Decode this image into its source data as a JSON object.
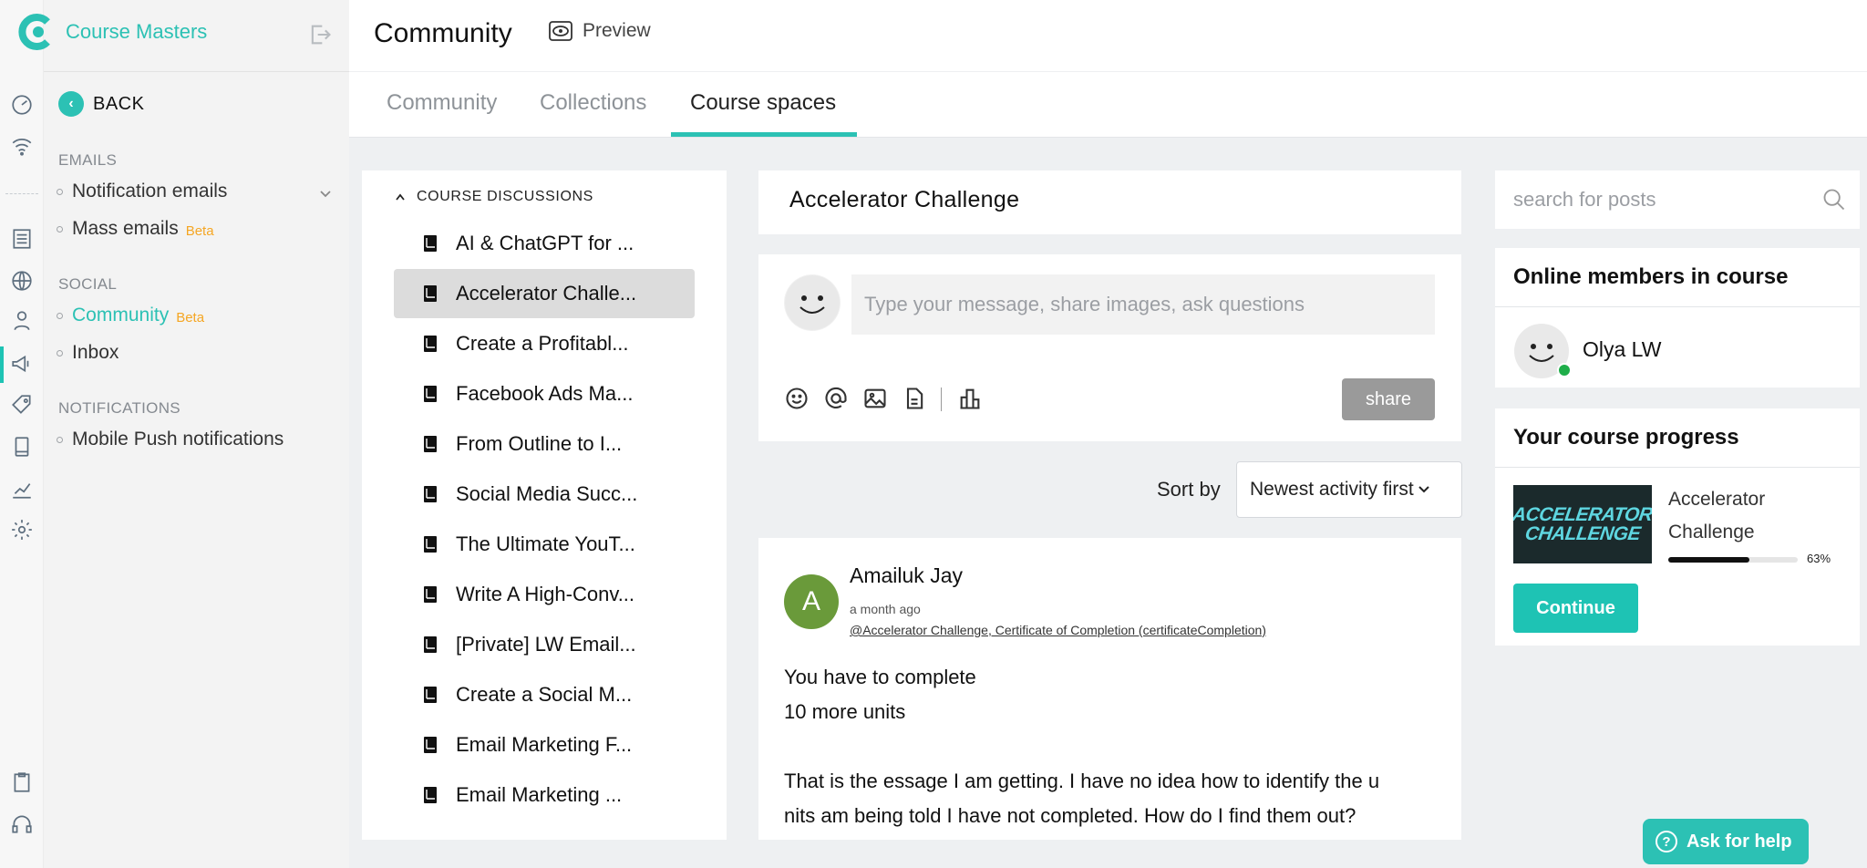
{
  "app": {
    "brand": "Course Masters",
    "page_title": "Community",
    "preview_label": "Preview"
  },
  "sidebar": {
    "back_label": "BACK",
    "sections": [
      {
        "title": "EMAILS",
        "items": [
          {
            "label": "Notification emails"
          },
          {
            "label": "Mass emails",
            "badge": "Beta"
          }
        ]
      },
      {
        "title": "SOCIAL",
        "items": [
          {
            "label": "Community",
            "badge": "Beta"
          },
          {
            "label": "Inbox"
          }
        ]
      },
      {
        "title": "NOTIFICATIONS",
        "items": [
          {
            "label": "Mobile Push notifications"
          }
        ]
      }
    ]
  },
  "tabs": [
    {
      "label": "Community"
    },
    {
      "label": "Collections"
    },
    {
      "label": "Course spaces"
    }
  ],
  "discussions": {
    "header": "COURSE DISCUSSIONS",
    "items": [
      "AI & ChatGPT for ...",
      "Accelerator Challe...",
      "Create a Profitabl...",
      "Facebook Ads Ma...",
      "From Outline to I...",
      "Social Media Succ...",
      "The Ultimate YouT...",
      "Write A High-Conv...",
      "[Private] LW Email...",
      "Create a Social M...",
      "Email Marketing F...",
      "Email Marketing ..."
    ]
  },
  "feed": {
    "space_title": "Accelerator Challenge",
    "composer_placeholder": "Type your message, share images, ask questions",
    "share_label": "share",
    "sort_label": "Sort by",
    "sort_value": "Newest activity first",
    "post": {
      "avatar_letter": "A",
      "author": "Amailuk Jay",
      "time": "a month ago",
      "mention": "@Accelerator Challenge, Certificate of Completion (certificateCompletion)",
      "lines": [
        "You have to complete",
        "10 more units",
        "That is the essage I am getting. I have no idea how to identify the u",
        "nits am being told I have not completed. How do I find them out?"
      ]
    }
  },
  "right": {
    "search_placeholder": "search for posts",
    "online_title": "Online members in course",
    "member_name": "Olya LW",
    "progress_title": "Your course progress",
    "course_name_line1": "Accelerator",
    "course_name_line2": "Challenge",
    "thumb_line1": "ACCELERATOR",
    "thumb_line2": "CHALLENGE",
    "progress_pct": "63%",
    "progress_value": 0.63,
    "continue_label": "Continue"
  },
  "help_label": "Ask for help",
  "colors": {
    "accent": "#2cc1b4",
    "beta": "#f5a623",
    "online": "#1fae4a"
  }
}
